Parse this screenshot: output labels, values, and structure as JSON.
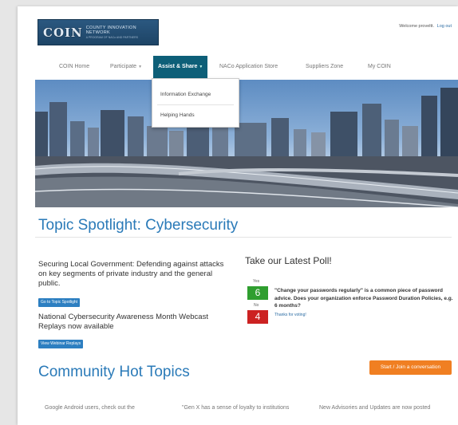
{
  "header": {
    "logo_mark": "COIN",
    "logo_title": "COUNTY INNOVATION NETWORK",
    "logo_subtitle": "A PROGRAM OF NACo AND PARTNERS",
    "welcome": "Welcome proveltt.",
    "logout": "Log out"
  },
  "nav": {
    "items": [
      {
        "label": "COIN Home"
      },
      {
        "label": "Participate"
      },
      {
        "label": "Assist & Share"
      },
      {
        "label": "NACo Application Store"
      },
      {
        "label": "Suppliers Zone"
      },
      {
        "label": "My COIN"
      }
    ],
    "active_index": 2
  },
  "dropdown": {
    "items": [
      {
        "label": "Information Exchange"
      },
      {
        "label": "Helping Hands"
      }
    ]
  },
  "spotlight": {
    "title": "Topic Spotlight: Cybersecurity",
    "story1": "Securing Local Government: Defending against attacks on key segments of private industry and the general public.",
    "button1": "Go to Topic Spotlight",
    "story2": "National Cybersecurity Awareness Month Webcast Replays now available",
    "button2": "View Webinar Replays"
  },
  "poll": {
    "title": "Take our Latest Poll!",
    "yes_label": "Yes",
    "yes_count": "6",
    "no_label": "No",
    "no_count": "4",
    "question": "\"Change your passwords regularly\" is a common piece of password advice. Does your organization enforce Password Duration Policies, e.g. 6 months?",
    "thanks": "Thanks for voting!",
    "colors": {
      "yes": "#2f9e2f",
      "no": "#cc2222"
    }
  },
  "hot_topics": {
    "title": "Community Hot Topics",
    "cta": "Start / Join a conversation",
    "items": [
      {
        "text": "Google Android users, check out the"
      },
      {
        "text": "\"Gen X has a sense of loyalty to institutions"
      },
      {
        "text": "New Advisories and Updates are now posted"
      }
    ]
  },
  "colors": {
    "accent": "#2a7ab8",
    "nav_active": "#0d5f78",
    "cta": "#f07f22",
    "button": "#2d7fc1"
  }
}
